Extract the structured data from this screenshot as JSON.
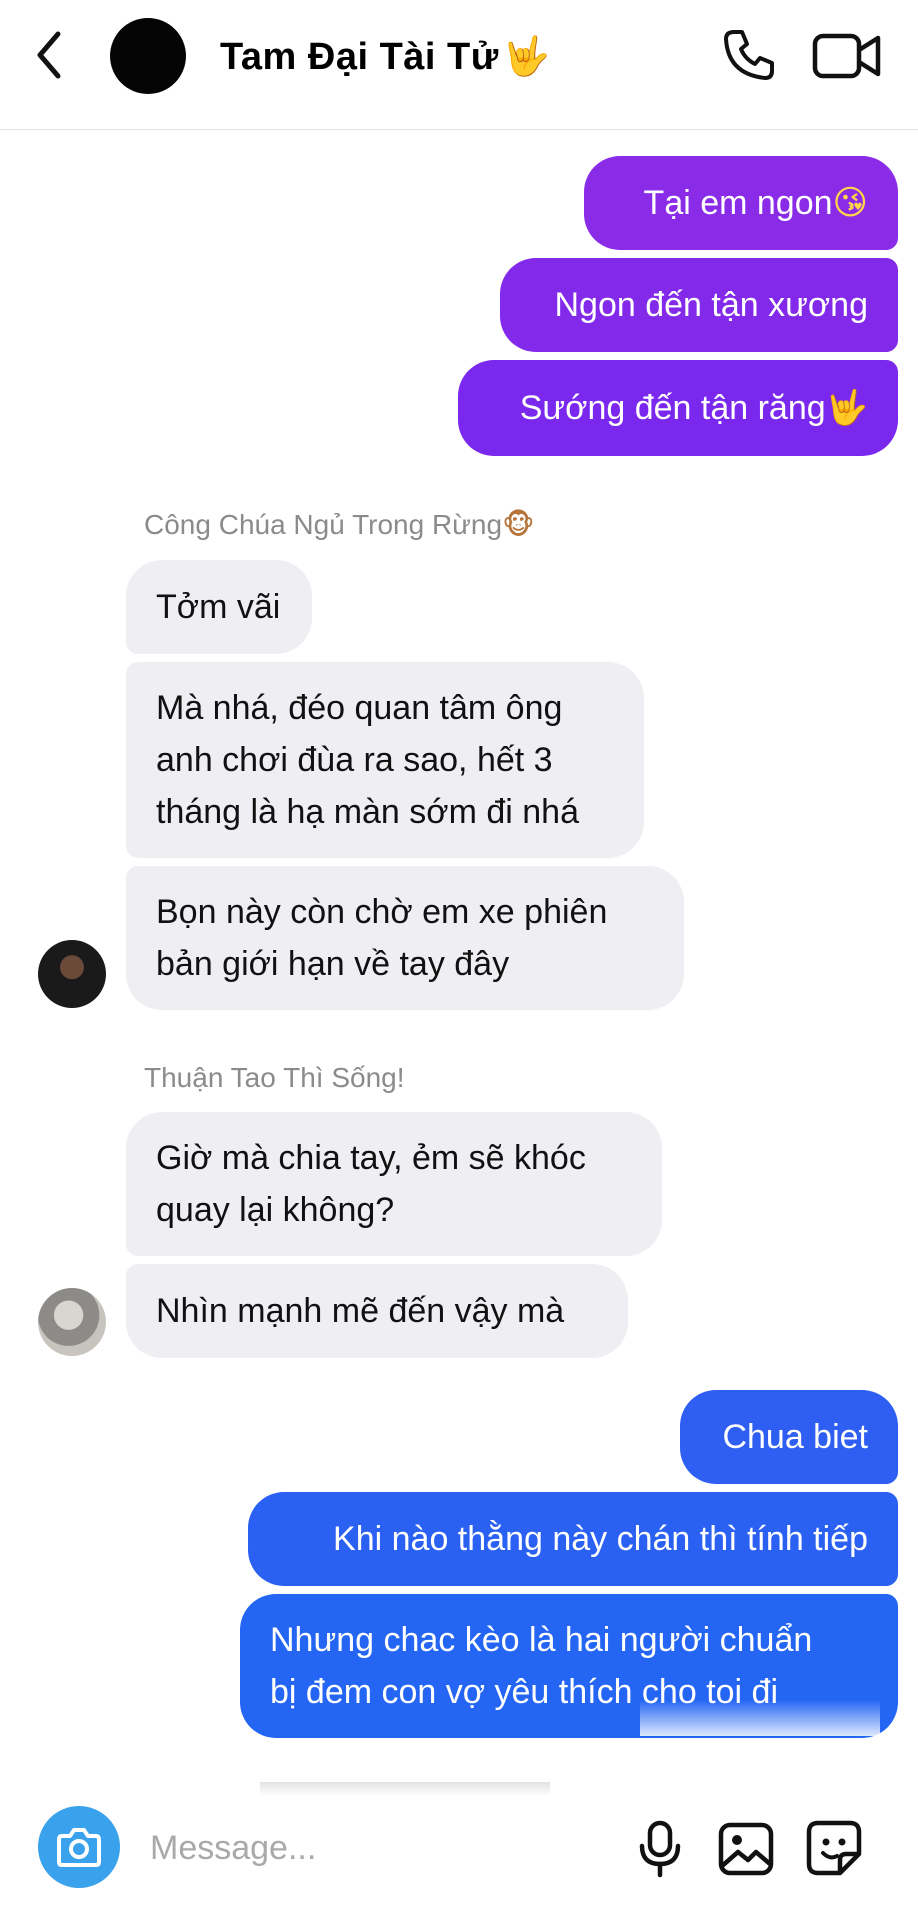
{
  "header": {
    "title": "Tam Đại Tài Tử",
    "title_emoji": "🤟"
  },
  "messages": {
    "m1": {
      "text": "Tại em ngon",
      "emoji": "😘"
    },
    "m2": {
      "text": "Ngon đến tận xương"
    },
    "m3": {
      "text": "Sướng đến tận răng",
      "emoji": "🤟"
    },
    "sender1": {
      "name": "Công Chúa Ngủ Trong Rừng",
      "emoji": "🐵"
    },
    "m4": {
      "text": "Tởm vãi"
    },
    "m5": {
      "line1": "Mà nhá, đéo quan tâm ông",
      "line2": "anh chơi đùa ra sao, hết 3",
      "line3": "tháng là hạ màn sớm đi nhá"
    },
    "m6": {
      "line1": "Bọn này còn chờ em xe phiên",
      "line2": "bản giới hạn về tay đây"
    },
    "sender2": {
      "name": "Thuận Tao Thì Sống!"
    },
    "m7": {
      "line1": "Giờ mà chia tay, ẻm sẽ khóc",
      "line2": "quay lại không?"
    },
    "m8": {
      "text": "Nhìn mạnh mẽ đến vậy mà"
    },
    "m9": {
      "text": "Chua biet"
    },
    "m10": {
      "text": "Khi nào thằng này chán thì tính tiếp"
    },
    "m11": {
      "line1": "Nhưng chac kèo là hai người chuẩn",
      "line2": "bị đem con vợ yêu thích cho toi đi"
    }
  },
  "composer": {
    "placeholder": "Message..."
  },
  "colors": {
    "outgoing_purple": "#8a2be8",
    "outgoing_blue": "#2563f0",
    "incoming_gray": "#efeff3",
    "camera_button": "#3aa2ec"
  },
  "icons": [
    "back-chevron-icon",
    "phone-icon",
    "video-camera-icon",
    "camera-icon",
    "microphone-icon",
    "gallery-icon",
    "sticker-icon"
  ]
}
